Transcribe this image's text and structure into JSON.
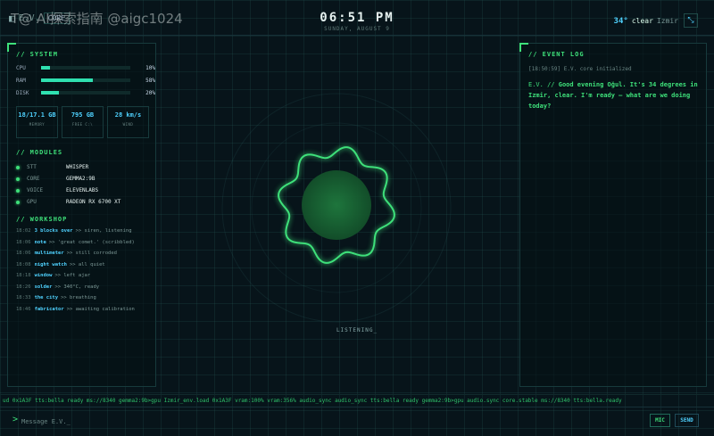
{
  "header": {
    "brand": "E.V.",
    "brand_tag": "CORE",
    "watermark": "T@ AI探索指南 @aigc1024",
    "time": "06:51 PM",
    "date": "SUNDAY, AUGUST 9",
    "temperature": "34°",
    "condition": "clear",
    "city": "Izmir",
    "expand_icon": "expand-icon"
  },
  "system": {
    "title": "// SYSTEM",
    "stats": [
      {
        "label": "CPU",
        "value": 10,
        "text": "10%"
      },
      {
        "label": "RAM",
        "value": 58,
        "text": "58%"
      },
      {
        "label": "DISK",
        "value": 20,
        "text": "20%"
      }
    ],
    "tiles": [
      {
        "value": "18/17.1 GB",
        "label": "MEMORY"
      },
      {
        "value": "795 GB",
        "label": "FREE C:\\"
      },
      {
        "value": "28 km/s",
        "label": "WIND"
      }
    ]
  },
  "modules": {
    "title": "// MODULES",
    "items": [
      {
        "name": "STT",
        "value": "WHISPER"
      },
      {
        "name": "CORE",
        "value": "GEMMA2:9B"
      },
      {
        "name": "VOICE",
        "value": "ELEVENLABS"
      },
      {
        "name": "GPU",
        "value": "RADEON RX 6700 XT"
      }
    ]
  },
  "workshop": {
    "title": "// WORKSHOP",
    "items": [
      {
        "time": "18:02",
        "name": "3 blocks over",
        "status": ">> siren, listening"
      },
      {
        "time": "18:06",
        "name": "note",
        "status": ">> 'great comet.' (scribbled)"
      },
      {
        "time": "18:06",
        "name": "multimeter",
        "status": ">> still corroded"
      },
      {
        "time": "18:08",
        "name": "night watch",
        "status": ">> all quiet"
      },
      {
        "time": "18:18",
        "name": "window",
        "status": ">> left ajar"
      },
      {
        "time": "18:26",
        "name": "solder",
        "status": ">> 340°C, ready"
      },
      {
        "time": "18:33",
        "name": "the city",
        "status": ">> breathing"
      },
      {
        "time": "18:46",
        "name": "fabricator",
        "status": ">> awaiting calibration"
      }
    ]
  },
  "event_log": {
    "title": "// EVENT LOG",
    "entry": "[18:50:59] E.V. core initialized",
    "speaker": "E.V. //",
    "message": "Good evening Oğul. It's 34 degrees in Izmir, clear. I'm ready — what are we doing today?"
  },
  "center": {
    "status": "LISTENING_"
  },
  "ticker": {
    "text": "ud 0x1A3F tts:bella ready ms://8340 gemma2:9b>gpu Izmir_env.load 0x1A3F vram:100% vram:356% audio_sync audio_sync tts:bella ready gemma2:9b>gpu audio.sync core.stable ms://8340 tts:bella.ready"
  },
  "input": {
    "prompt": ">",
    "placeholder": "Message E.V._",
    "mic_label": "MIC",
    "send_label": "SEND"
  },
  "colors": {
    "accent_green": "#3ee07a",
    "accent_cyan": "#4fd2ff",
    "background": "#07141a"
  }
}
